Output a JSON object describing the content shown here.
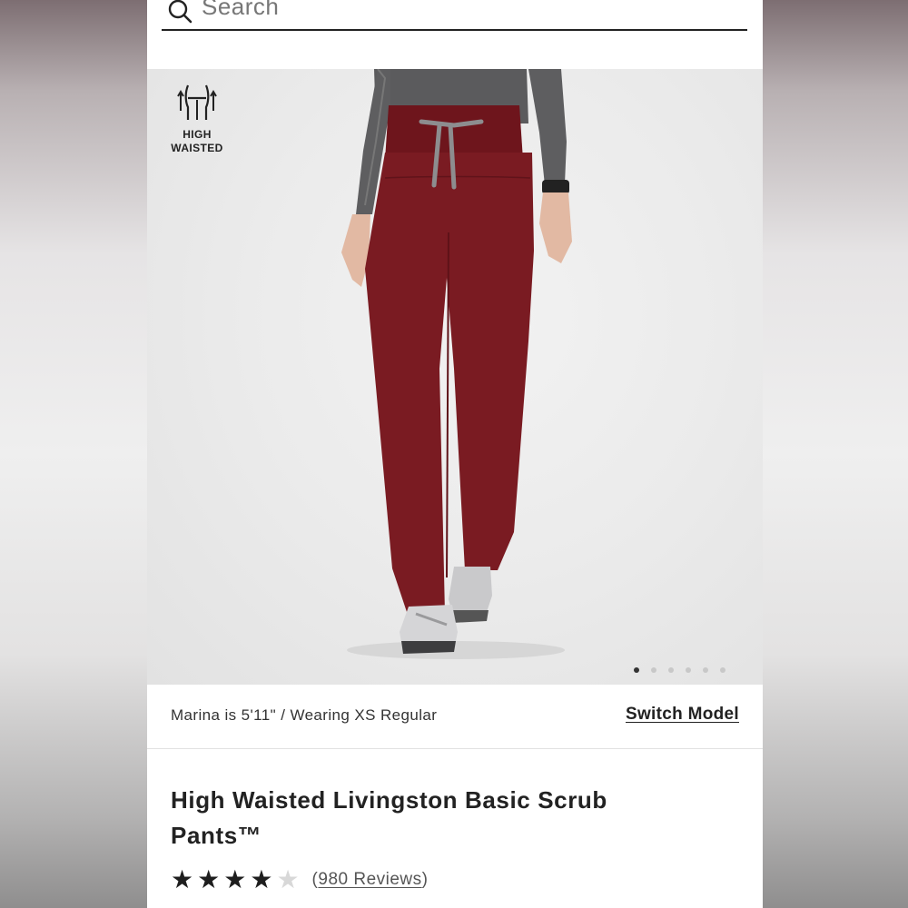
{
  "search": {
    "placeholder": "Search"
  },
  "badge": {
    "line1": "HIGH",
    "line2": "WAISTED"
  },
  "gallery": {
    "image_count": 6,
    "active_index": 0
  },
  "model": {
    "info": "Marina is 5'11\" / Wearing XS Regular",
    "switch_label": "Switch Model"
  },
  "product": {
    "title": "High Waisted Livingston Basic Scrub Pants™",
    "rating": 4,
    "rating_max": 5,
    "reviews_open": "(",
    "reviews_label": "980 Reviews",
    "reviews_close": ")"
  },
  "colors": {
    "pants": "#7a1b22",
    "shirt": "#5b5b5d",
    "drawstring": "#8d8d8f"
  },
  "icons": {
    "search": "search-icon",
    "badge": "high-waist-icon"
  }
}
